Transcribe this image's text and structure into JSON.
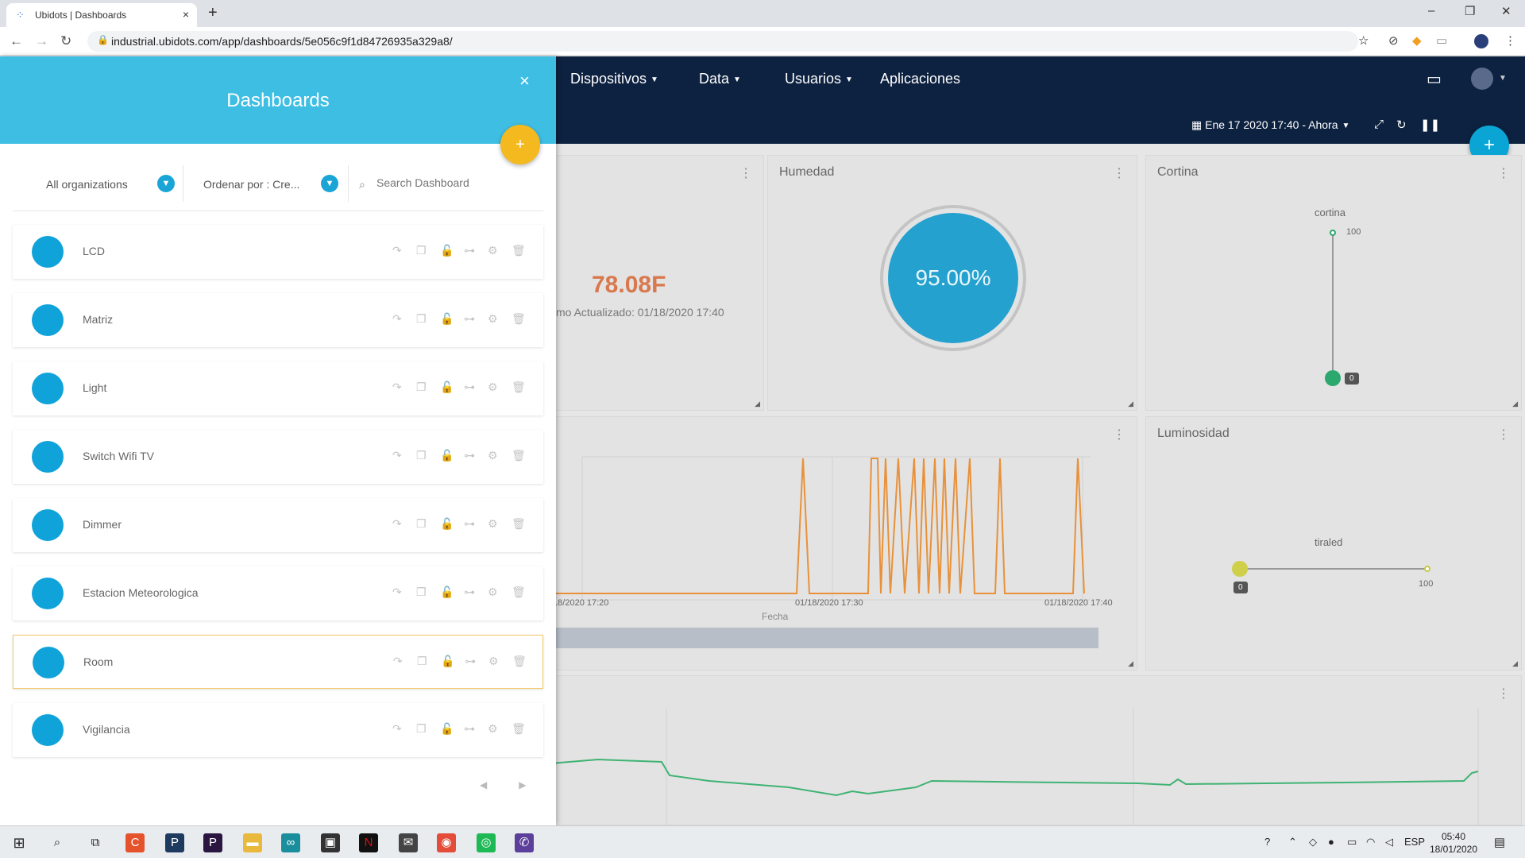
{
  "browser": {
    "tab_title": "Ubidots | Dashboards",
    "url": "industrial.ubidots.com/app/dashboards/5e056c9f1d84726935a329a8/",
    "new_tab": "+",
    "tab_close": "×"
  },
  "app_nav": {
    "menus": [
      {
        "label": "Dispositivos",
        "caret": true
      },
      {
        "label": "Data",
        "caret": true
      },
      {
        "label": "Usuarios",
        "caret": true
      },
      {
        "label": "Aplicaciones",
        "caret": false
      }
    ],
    "date_range": "Ene 17 2020 17:40 - Ahora"
  },
  "widgets": {
    "temperature": {
      "value": "78.08F",
      "updated": "mo Actualizado: 01/18/2020 17:40"
    },
    "humidity": {
      "title": "Humedad",
      "value": "95.00%",
      "level": 0.95
    },
    "curtain": {
      "title": "Cortina",
      "label": "cortina",
      "max": "100",
      "value": "0",
      "fraction": 0.0
    },
    "chart": {
      "xlabel": "Fecha",
      "ticks": [
        "/18/2020 17:20",
        "01/18/2020 17:30",
        "01/18/2020 17:40"
      ]
    },
    "luminosity": {
      "title": "Luminosidad",
      "label": "tiraled",
      "value": "0",
      "max": "100",
      "fraction": 0.0
    }
  },
  "panel": {
    "title": "Dashboards",
    "close": "×",
    "add": "+",
    "org_filter": "All organizations",
    "sort": "Ordenar por : Cre...",
    "search_placeholder": "Search Dashboard",
    "dashboards": [
      {
        "name": "LCD",
        "selected": false
      },
      {
        "name": "Matriz",
        "selected": false
      },
      {
        "name": "Light",
        "selected": false
      },
      {
        "name": "Switch Wifi TV",
        "selected": false
      },
      {
        "name": "Dimmer",
        "selected": false
      },
      {
        "name": "Estacion Meteorologica",
        "selected": false
      },
      {
        "name": "Room",
        "selected": true
      },
      {
        "name": "Vigilancia",
        "selected": false
      }
    ]
  },
  "taskbar": {
    "lang": "ESP",
    "time": "05:40",
    "date": "18/01/2020"
  },
  "colors": {
    "panel_header": "#3fbee4",
    "nav_bg": "#0d2140",
    "accent_orange": "#f4b91e",
    "accent_blue": "#10a3da",
    "chart_line": "#e8913a",
    "trend_line": "#3fb373"
  }
}
